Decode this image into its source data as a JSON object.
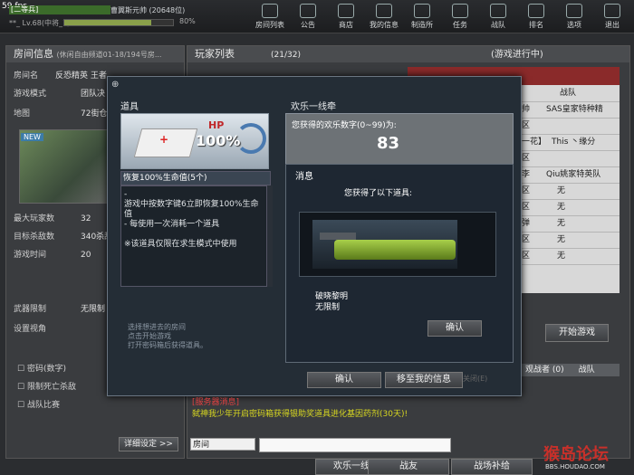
{
  "fps": "59 fps",
  "player": {
    "rank_title": "[二等兵]",
    "name": "曹翼斯元帅 (20648位)",
    "level": "**_ Lv.68(中将_1)",
    "xp_pct": "80%",
    "xp_fraction": 0.8
  },
  "nav": [
    {
      "label": "房间列表",
      "icon": "monitor-icon"
    },
    {
      "label": "公告",
      "icon": "megaphone-icon"
    },
    {
      "label": "商店",
      "icon": "shop-icon"
    },
    {
      "label": "我的信息",
      "icon": "profile-icon"
    },
    {
      "label": "制造所",
      "icon": "factory-icon"
    },
    {
      "label": "任务",
      "icon": "task-icon"
    },
    {
      "label": "战队",
      "icon": "shield-icon"
    },
    {
      "label": "排名",
      "icon": "trophy-icon"
    },
    {
      "label": "选项",
      "icon": "gear-icon"
    },
    {
      "label": "退出",
      "icon": "power-icon"
    }
  ],
  "room": {
    "header": "房间信息",
    "channel": "(休闲自由频道01-18/194号房...",
    "rows": [
      {
        "label": "房间名",
        "value": "反恐精英 王者"
      },
      {
        "label": "游戏模式",
        "value": "团队决"
      },
      {
        "label": "地图",
        "value": "72街仓库"
      },
      {
        "label": "最大玩家数",
        "value": "32"
      },
      {
        "label": "目标杀敌数",
        "value": "340杀敌"
      },
      {
        "label": "游戏时间",
        "value": "20"
      },
      {
        "label": "武器限制",
        "value": "无限制"
      },
      {
        "label": "设置视角",
        "value": ""
      }
    ],
    "new_tag": "NEW",
    "options": [
      "密码(数字)",
      "限制死亡杀敌",
      "战队比赛"
    ],
    "settings_btn": "详细设定 >>"
  },
  "players": {
    "header": "玩家列表",
    "count": "(21/32)",
    "status": "(游戏进行中)",
    "col_clan": "战队",
    "rows": [
      {
        "name": "帅",
        "clan": "SAS皇家特种精"
      },
      {
        "name": "区",
        "clan": ""
      },
      {
        "name": "一花】",
        "clan": "This 丶缘分"
      },
      {
        "name": "区",
        "clan": ""
      },
      {
        "name": "李",
        "clan": "Qiu姚家特英队"
      },
      {
        "name": "区",
        "clan": "无"
      },
      {
        "name": "区",
        "clan": "无"
      },
      {
        "name": "弹",
        "clan": "无"
      },
      {
        "name": "区",
        "clan": "无"
      },
      {
        "name": "区",
        "clan": "无"
      }
    ],
    "start_btn": "开始游戏",
    "observer": "观战者 (0)",
    "observer_clan": "战队"
  },
  "dialog": {
    "item_title": "道具",
    "hp_label": "HP",
    "hp_value": "100%",
    "item_name": "恢复100%生命值(5个)",
    "desc": [
      "-",
      "游戏中按数字键6立即恢复100%生命值",
      "- 每使用一次消耗一个道具",
      "",
      "※该道具仅限在求生模式中使用"
    ],
    "hint": [
      "选择想进去的房间",
      "点击开始游戏",
      "打开密码箱后获得道具。"
    ],
    "roulette_title": "欢乐一线牵",
    "got_number_label": "您获得的欢乐数字(0~99)为:",
    "number": "83",
    "msg_title": "消息",
    "msg_text": "您获得了以下道具:",
    "gun_name": "破晓黎明",
    "gun_duration": "无限制",
    "msg_ok": "确认",
    "confirm": "确认",
    "to_info": "移至我的信息",
    "close_hint": "关闭(E)"
  },
  "chat": {
    "sys_title": "[服务器消息]",
    "sys_text": "弑神我少年开启密码箱获得银助奖道具进化基因药剂(30天)!",
    "channel": "房间"
  },
  "bottom_buttons": [
    "欢乐一线牵",
    "战友",
    "战场补给"
  ],
  "watermark": {
    "logo": "猴岛论坛",
    "site": "BBS.HOUDAO.COM"
  }
}
